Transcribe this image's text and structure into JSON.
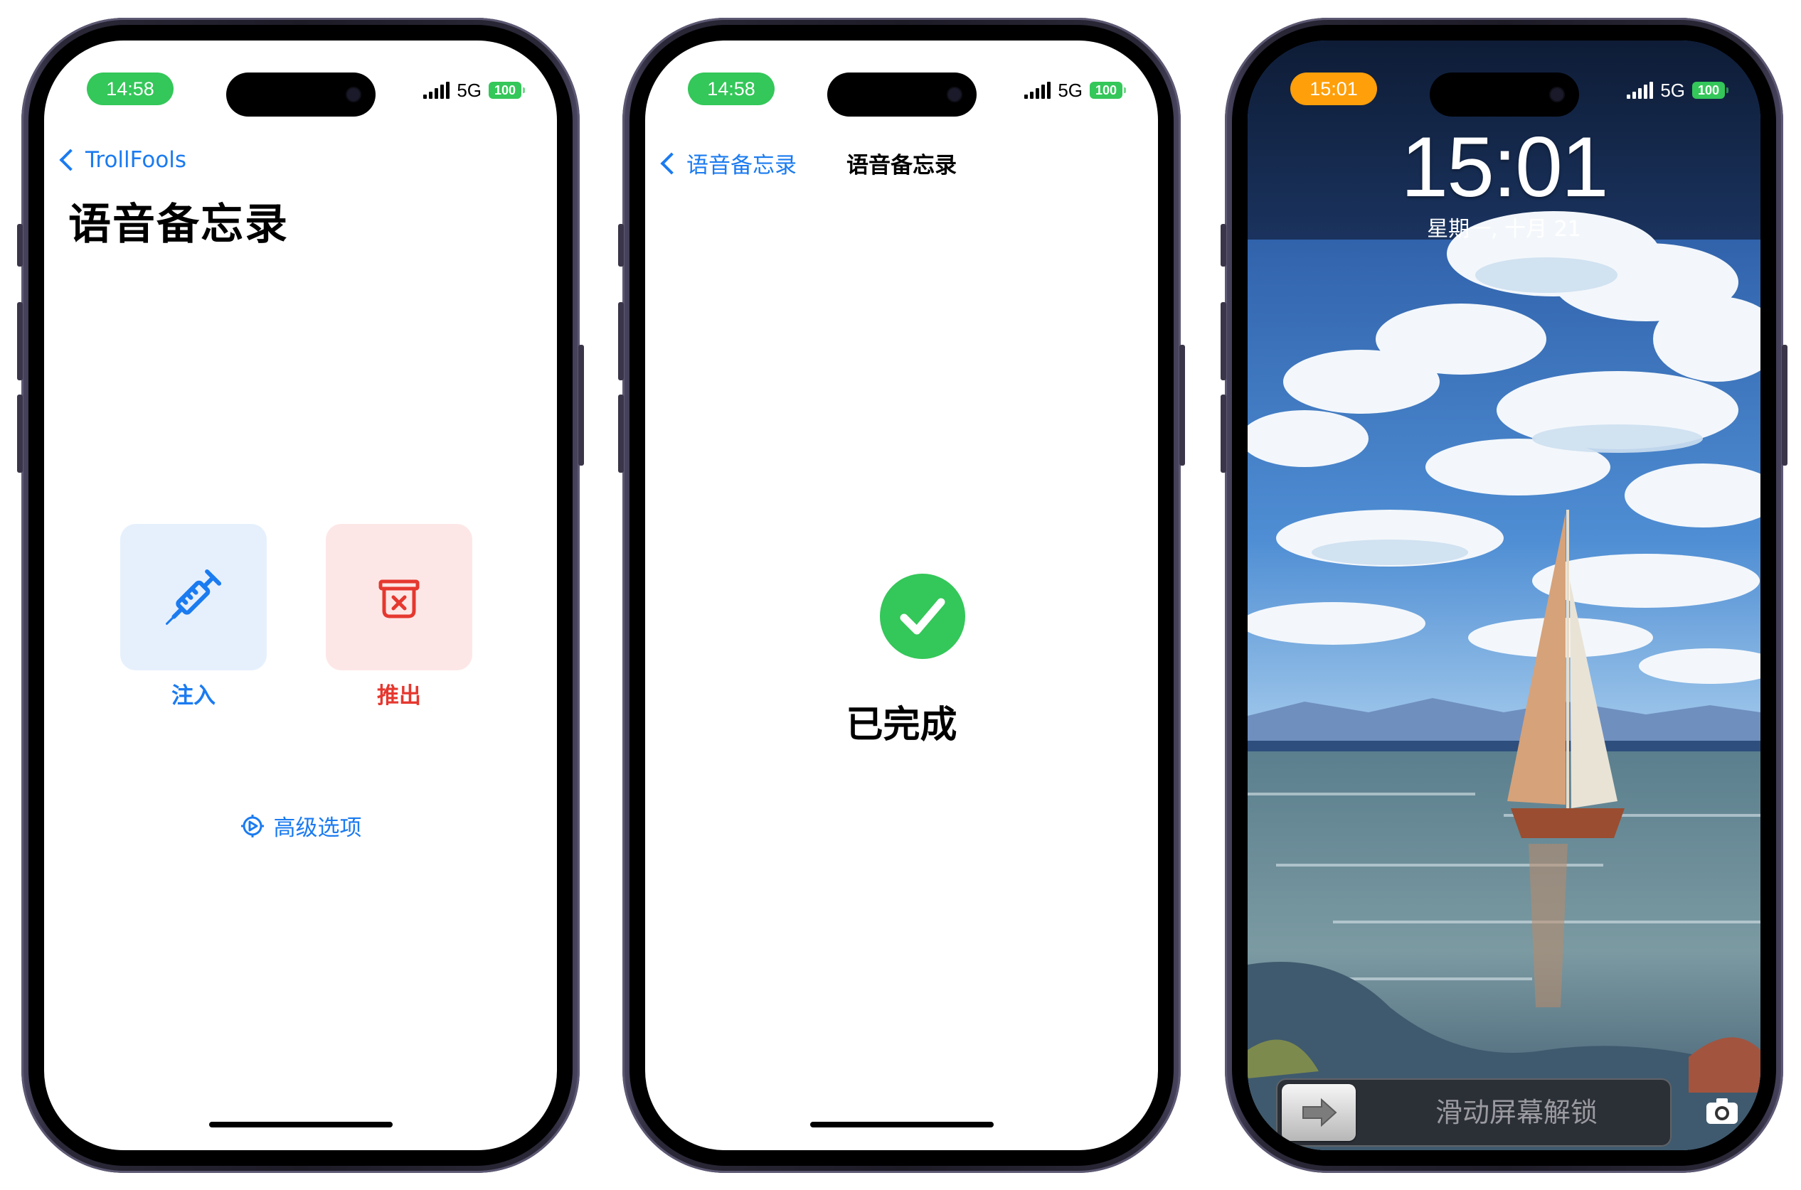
{
  "phones": [
    {
      "status": {
        "time": "14:58",
        "network": "5G",
        "battery": "100"
      },
      "back_label": "TrollFools",
      "title": "语音备忘录",
      "inject_label": "注入",
      "eject_label": "推出",
      "advanced_label": "高级选项",
      "icons": [
        "syringe-icon",
        "eject-box-icon",
        "gear-icon"
      ]
    },
    {
      "status": {
        "time": "14:58",
        "network": "5G",
        "battery": "100"
      },
      "back_label": "语音备忘录",
      "nav_title": "语音备忘录",
      "done_label": "已完成",
      "icons": [
        "checkmark-circle-icon"
      ]
    },
    {
      "status": {
        "time": "15:01",
        "network": "5G",
        "battery": "100"
      },
      "lock_time": "15:01",
      "lock_date": "星期一, 十月 21",
      "slide_text": "滑动屏幕解锁",
      "icons": [
        "arrow-right-icon",
        "camera-icon"
      ]
    }
  ],
  "colors": {
    "accent_blue": "#1b7bf0",
    "eject_red": "#e5382f",
    "success_green": "#34c759",
    "orange": "#ff9f0a"
  }
}
